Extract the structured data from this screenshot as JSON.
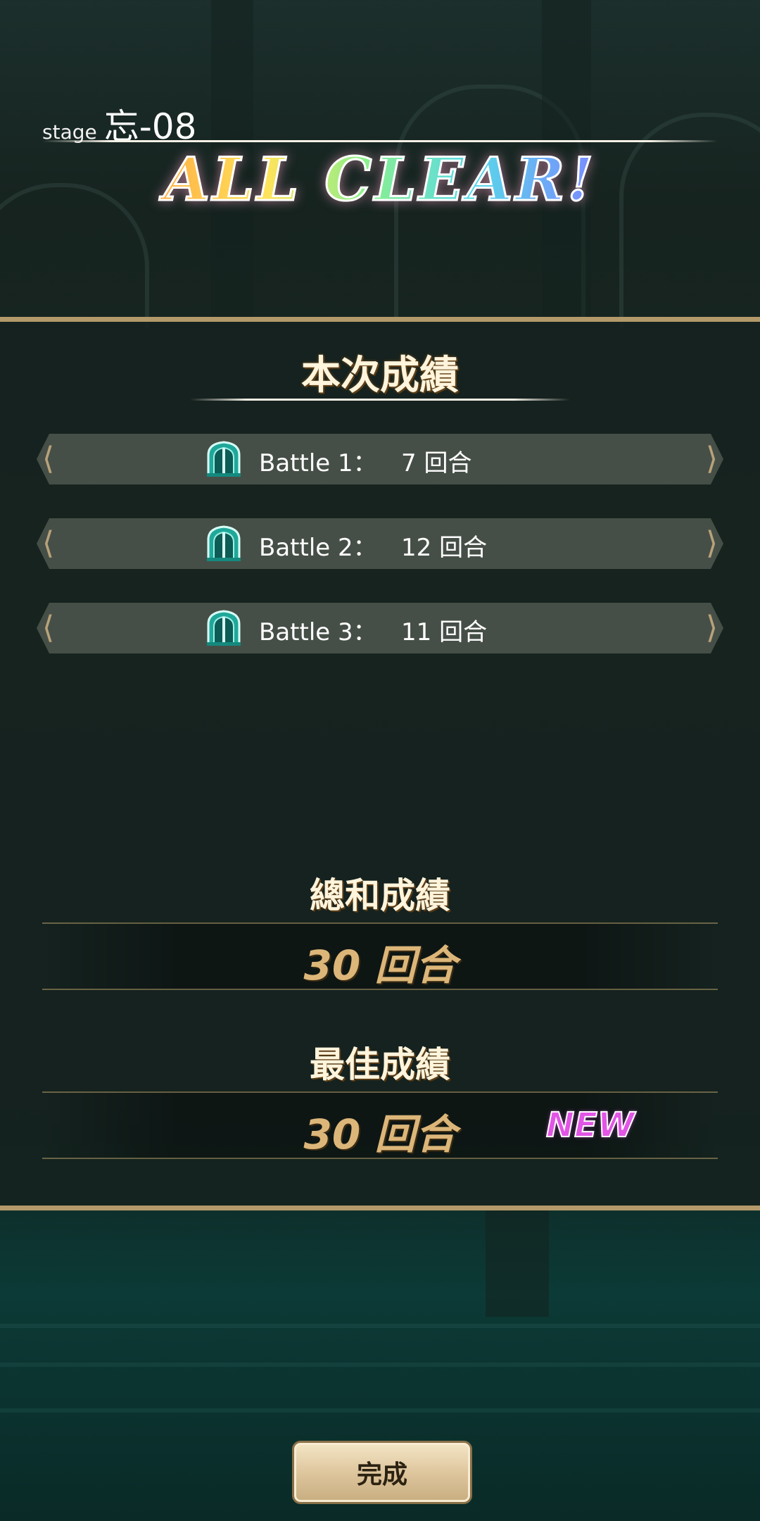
{
  "header": {
    "stage_prefix": "stage",
    "stage_name": "忘-08",
    "clear_banner": "ALL CLEAR!"
  },
  "current_result": {
    "title": "本次成績",
    "battles": [
      {
        "label": "Battle 1：",
        "value": "7 回合",
        "icon": "gate-icon"
      },
      {
        "label": "Battle 2：",
        "value": "12 回合",
        "icon": "gate-icon"
      },
      {
        "label": "Battle 3：",
        "value": "11 回合",
        "icon": "gate-icon"
      }
    ]
  },
  "total": {
    "title": "總和成績",
    "value": "30 回合"
  },
  "best": {
    "title": "最佳成績",
    "value": "30 回合",
    "badge": "NEW"
  },
  "footer": {
    "done_label": "完成"
  },
  "colors": {
    "accent_gold": "#b49a6a",
    "result_gold": "#dcb679",
    "new_badge": "#e255e6",
    "row_bg": "#464f47"
  }
}
